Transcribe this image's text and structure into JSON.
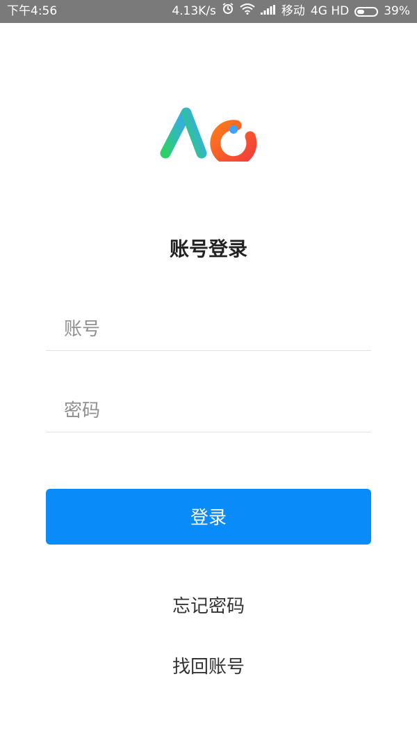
{
  "status_bar": {
    "time": "下午4:56",
    "speed": "4.13K/s",
    "carrier": "移动",
    "network": "4G HD",
    "battery": "39%",
    "battery_level": 0.39,
    "icons": [
      "alarm-icon",
      "wifi-icon",
      "signal-icon",
      "battery-icon"
    ]
  },
  "app": {
    "logo_colors": {
      "green": "#2bd168",
      "blue": "#3aa4ff",
      "orange": "#ff7a1a",
      "red": "#f23b3b"
    },
    "title": "账号登录"
  },
  "form": {
    "account_placeholder": "账号",
    "password_placeholder": "密码",
    "login_button": "登录",
    "accent_color": "#0a8bfa"
  },
  "links": {
    "forgot_password": "忘记密码",
    "recover_account": "找回账号"
  }
}
